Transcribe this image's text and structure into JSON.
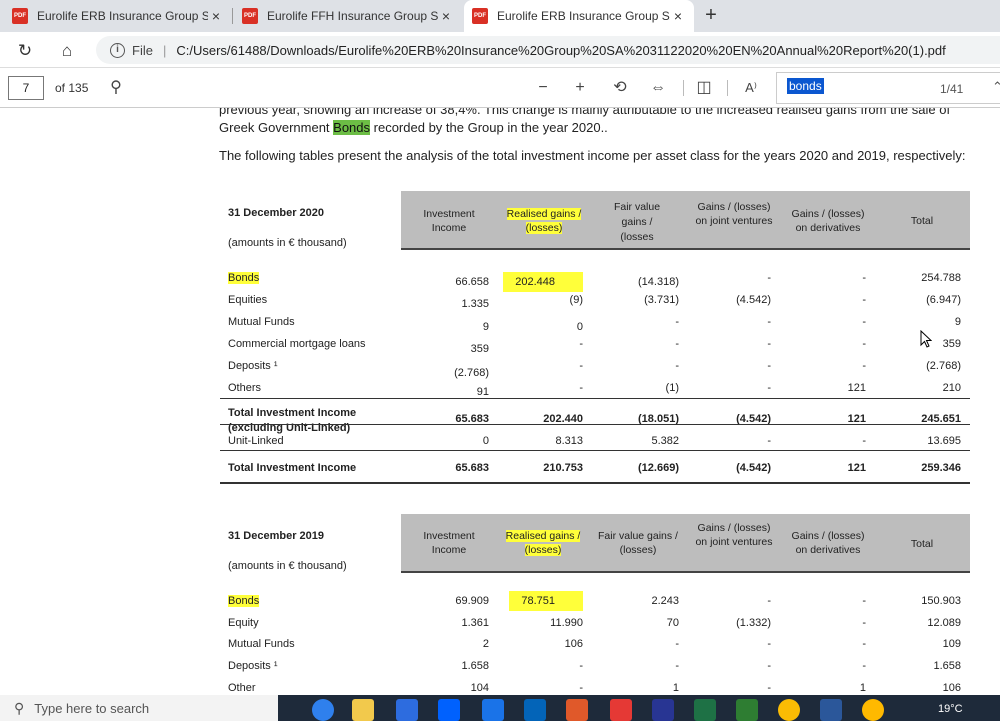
{
  "tabs": [
    {
      "title": "Eurolife ERB Insurance Group SA",
      "icon": "pdf-icon",
      "active": false
    },
    {
      "title": "Eurolife FFH Insurance Group SA",
      "icon": "pdf-icon",
      "active": false
    },
    {
      "title": "Eurolife ERB Insurance Group SA",
      "icon": "pdf-icon",
      "active": true
    }
  ],
  "tab_close": "×",
  "new_tab": "+",
  "address": {
    "file_label": "File",
    "separator": "|",
    "url": "C:/Users/61488/Downloads/Eurolife%20ERB%20Insurance%20Group%20SA%2031122020%20EN%20Annual%20Report%20(1).pdf"
  },
  "pdf_toolbar": {
    "page": "7",
    "of_pages": "of 135",
    "find_text": "bonds",
    "find_count": "1/41"
  },
  "document": {
    "cut_line": "previous year, showing an increase of 38,4%. This change is mainly attributable to the increased realised gains from the sale of",
    "line1_pre": "Greek Government ",
    "line1_hl": "Bonds",
    "line1_post": " recorded by the Group in the year 2020..",
    "line2": "The following tables present the analysis of the total investment income per asset class for the years 2020 and 2019, respectively:",
    "table2020": {
      "date": "31 December 2020",
      "unit": "(amounts in € thousand)",
      "headers": [
        "Investment Income",
        "Realised gains / (losses)",
        "Fair value gains / (losses",
        "Gains / (losses) on joint ventures",
        "Gains / (losses) on derivatives",
        "Total"
      ],
      "rows": [
        {
          "label": "Bonds",
          "values": [
            "66.658",
            "202.448",
            "(14.318)",
            "-",
            "-",
            "254.788"
          ]
        },
        {
          "label": "Equities",
          "values": [
            "1.335",
            "(9)",
            "(3.731)",
            "(4.542)",
            "-",
            "(6.947)"
          ]
        },
        {
          "label": "Mutual Funds",
          "values": [
            "9",
            "0",
            "-",
            "-",
            "-",
            "9"
          ]
        },
        {
          "label": "Commercial mortgage loans",
          "values": [
            "359",
            "-",
            "-",
            "-",
            "-",
            "359"
          ]
        },
        {
          "label": "Deposits ¹",
          "values": [
            "(2.768)",
            "-",
            "-",
            "-",
            "-",
            "(2.768)"
          ]
        },
        {
          "label": "Others",
          "values": [
            "91",
            "-",
            "(1)",
            "-",
            "121",
            "210"
          ]
        },
        {
          "label": "Total Investment Income (excluding Unit-Linked)",
          "values": [
            "65.683",
            "202.440",
            "(18.051)",
            "(4.542)",
            "121",
            "245.651"
          ]
        },
        {
          "label": "Unit-Linked",
          "values": [
            "0",
            "8.313",
            "5.382",
            "-",
            "-",
            "13.695"
          ]
        },
        {
          "label": "Total Investment Income",
          "values": [
            "65.683",
            "210.753",
            "(12.669)",
            "(4.542)",
            "121",
            "259.346"
          ]
        }
      ]
    },
    "table2019": {
      "date": "31 December 2019",
      "unit": "(amounts in € thousand)",
      "headers": [
        "Investment Income",
        "Realised gains / (losses)",
        "Fair value gains / (losses)",
        "Gains / (losses) on joint ventures",
        "Gains / (losses) on derivatives",
        "Total"
      ],
      "rows": [
        {
          "label": "Bonds",
          "values": [
            "69.909",
            "78.751",
            "2.243",
            "-",
            "-",
            "150.903"
          ]
        },
        {
          "label": "Equity",
          "values": [
            "1.361",
            "11.990",
            "70",
            "(1.332)",
            "-",
            "12.089"
          ]
        },
        {
          "label": "Mutual Funds",
          "values": [
            "2",
            "106",
            "-",
            "-",
            "-",
            "109"
          ]
        },
        {
          "label": "Deposits ¹",
          "values": [
            "1.658",
            "-",
            "-",
            "-",
            "-",
            "1.658"
          ]
        },
        {
          "label": "Other",
          "values": [
            "104",
            "-",
            "1",
            "-",
            "1",
            "106"
          ]
        }
      ]
    }
  },
  "taskbar": {
    "search_placeholder": "Type here to search",
    "temperature": "19°C"
  },
  "colors": {
    "find_highlight": "#6cbd45",
    "yellow_highlight": "#ffff3a",
    "header_bg": "#bdbdbd"
  }
}
